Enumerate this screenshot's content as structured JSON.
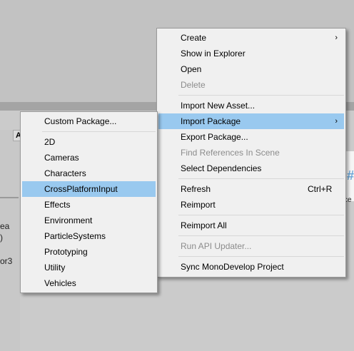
{
  "background": {
    "column_header": "A",
    "side_text": [
      "ea",
      ")",
      "or3"
    ],
    "asset_glyph": "#",
    "asset_label": "ce"
  },
  "context_menu": {
    "items": [
      {
        "label": "Create",
        "submenu": true
      },
      {
        "label": "Show in Explorer"
      },
      {
        "label": "Open"
      },
      {
        "label": "Delete",
        "disabled": true
      },
      {
        "label": "Import New Asset..."
      },
      {
        "label": "Import Package",
        "submenu": true,
        "highlighted": true
      },
      {
        "label": "Export Package..."
      },
      {
        "label": "Find References In Scene",
        "disabled": true
      },
      {
        "label": "Select Dependencies"
      },
      {
        "label": "Refresh",
        "shortcut": "Ctrl+R"
      },
      {
        "label": "Reimport"
      },
      {
        "label": "Reimport All"
      },
      {
        "label": "Run API Updater...",
        "disabled": true
      },
      {
        "label": "Sync MonoDevelop Project"
      }
    ],
    "submenu_arrow": "›"
  },
  "import_package_menu": {
    "items": [
      {
        "label": "Custom Package..."
      },
      {
        "label": "2D"
      },
      {
        "label": "Cameras"
      },
      {
        "label": "Characters"
      },
      {
        "label": "CrossPlatformInput",
        "highlighted": true
      },
      {
        "label": "Effects"
      },
      {
        "label": "Environment"
      },
      {
        "label": "ParticleSystems"
      },
      {
        "label": "Prototyping"
      },
      {
        "label": "Utility"
      },
      {
        "label": "Vehicles"
      }
    ]
  },
  "colors": {
    "highlight": "#99c9ef",
    "menu_bg": "#f0f0f0",
    "disabled_text": "#8c8c8c"
  }
}
